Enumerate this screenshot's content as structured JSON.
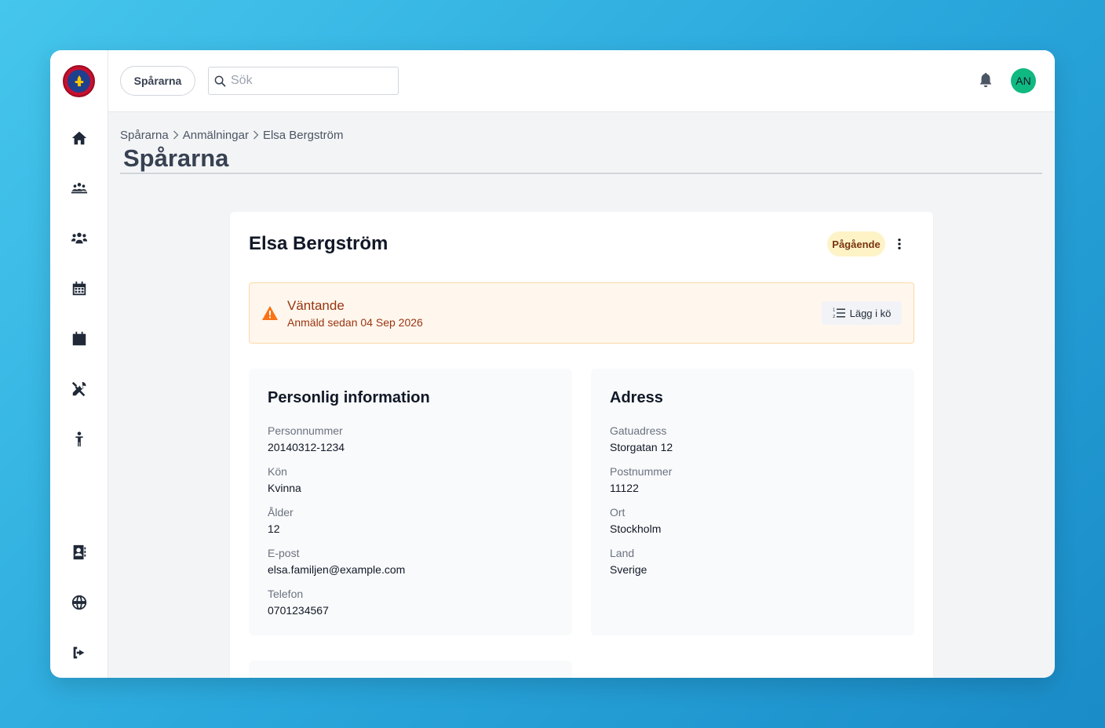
{
  "header": {
    "org_label": "Spårarna",
    "search_placeholder": "Sök",
    "avatar_initials": "AN"
  },
  "colors": {
    "accent": "#10b981",
    "status_badge_bg": "#fef3c7",
    "alert_bg": "#fff7ed",
    "alert_text": "#9a3412",
    "warning_icon": "#f97316"
  },
  "sidebar": {
    "icons": [
      "home-icon",
      "people-group-icon",
      "users-icon",
      "calendar-days-icon",
      "calendar-icon",
      "tools-icon",
      "child-icon",
      "address-book-icon",
      "globe-icon",
      "logout-icon"
    ]
  },
  "breadcrumb": [
    "Spårarna",
    "Anmälningar",
    "Elsa Bergström"
  ],
  "page_title": "Spårarna",
  "record": {
    "name": "Elsa Bergström",
    "status": "Pågående"
  },
  "alert": {
    "title": "Väntande",
    "subtitle": "Anmäld sedan 04 Sep 2026",
    "button_label": "Lägg i kö"
  },
  "personal": {
    "title": "Personlig information",
    "fields": [
      {
        "label": "Personnummer",
        "value": "20140312-1234"
      },
      {
        "label": "Kön",
        "value": "Kvinna"
      },
      {
        "label": "Ålder",
        "value": "12"
      },
      {
        "label": "E-post",
        "value": "elsa.familjen@example.com"
      },
      {
        "label": "Telefon",
        "value": "0701234567"
      }
    ]
  },
  "address": {
    "title": "Adress",
    "fields": [
      {
        "label": "Gatuadress",
        "value": "Storgatan 12"
      },
      {
        "label": "Postnummer",
        "value": "11122"
      },
      {
        "label": "Ort",
        "value": "Stockholm"
      },
      {
        "label": "Land",
        "value": "Sverige"
      }
    ]
  }
}
